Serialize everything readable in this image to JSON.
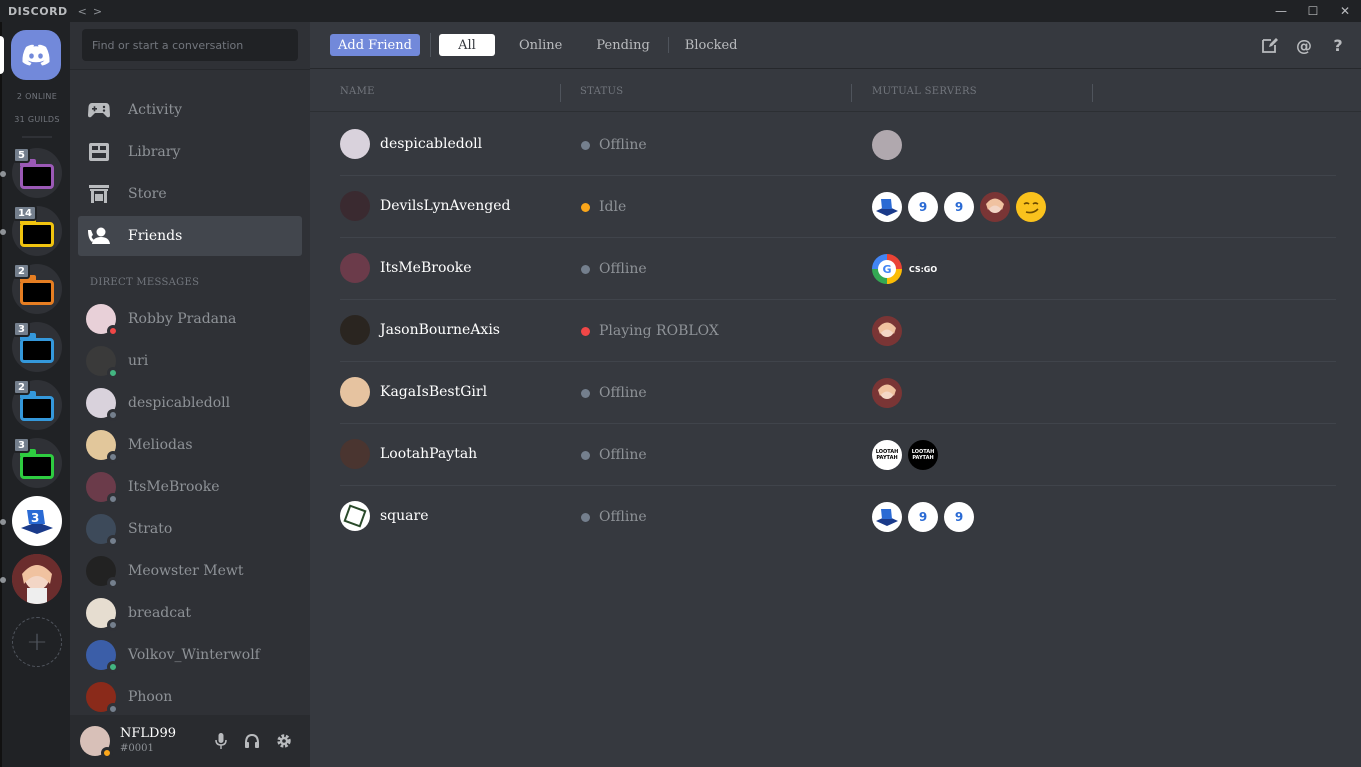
{
  "app": {
    "title": "DISCORD",
    "nav_back": "<",
    "nav_fwd": ">"
  },
  "window": {
    "min": "—",
    "max": "☐",
    "close": "✕"
  },
  "guilds": {
    "online": "2 ONLINE",
    "count": "31 GUILDS",
    "folders": [
      {
        "badge": "5",
        "color": "#9b59b6"
      },
      {
        "badge": "14",
        "color": "#f1c40f"
      },
      {
        "badge": "2",
        "color": "#e67e22"
      },
      {
        "badge": "3",
        "color": "#3498db"
      },
      {
        "badge": "2",
        "color": "#3498db"
      },
      {
        "badge": "3",
        "color": "#2ecc40"
      }
    ],
    "add": "+"
  },
  "sidebar": {
    "search_placeholder": "Find or start a conversation",
    "nav": [
      {
        "label": "Activity",
        "icon": "gamepad-icon"
      },
      {
        "label": "Library",
        "icon": "library-icon"
      },
      {
        "label": "Store",
        "icon": "store-icon"
      },
      {
        "label": "Friends",
        "icon": "friends-icon"
      }
    ],
    "dm_header": "DIRECT MESSAGES",
    "dms": [
      {
        "name": "Robby Pradana",
        "status": "dnd"
      },
      {
        "name": "uri",
        "status": "online"
      },
      {
        "name": "despicabledoll",
        "status": "offline"
      },
      {
        "name": "Meliodas",
        "status": "offline"
      },
      {
        "name": "ItsMeBrooke",
        "status": "offline"
      },
      {
        "name": "Strato",
        "status": "offline"
      },
      {
        "name": "Meowster Mewt",
        "status": "offline"
      },
      {
        "name": "breadcat",
        "status": "offline"
      },
      {
        "name": "Volkov_Winterwolf",
        "status": "online"
      },
      {
        "name": "Phoon",
        "status": "offline"
      }
    ],
    "user": {
      "name": "NFLD99",
      "tag": "#0001",
      "status": "idle"
    }
  },
  "colors": {
    "blurple": "#7289da",
    "online": "#43b581",
    "idle": "#faa61a",
    "dnd": "#f04747",
    "offline": "#747f8d"
  },
  "topbar": {
    "add_friend": "Add Friend",
    "tabs": [
      "All",
      "Online",
      "Pending",
      "Blocked"
    ],
    "active_tab": "All"
  },
  "table": {
    "headers": [
      "NAME",
      "STATUS",
      "MUTUAL SERVERS"
    ],
    "rows": [
      {
        "name": "despicabledoll",
        "status": "Offline",
        "state": "offline",
        "servers": [
          "anime"
        ]
      },
      {
        "name": "DevilsLynAvenged",
        "status": "Idle",
        "state": "idle",
        "servers": [
          "blue-3d",
          "g9",
          "g9",
          "anime",
          "smirk-emoji"
        ]
      },
      {
        "name": "ItsMeBrooke",
        "status": "Offline",
        "state": "offline",
        "servers": [
          "google",
          "csgo"
        ]
      },
      {
        "name": "JasonBourneAxis",
        "status": "Playing ROBLOX",
        "state": "dnd",
        "servers": [
          "anime"
        ]
      },
      {
        "name": "KagaIsBestGirl",
        "status": "Offline",
        "state": "offline",
        "servers": [
          "anime"
        ]
      },
      {
        "name": "LootahPaytah",
        "status": "Offline",
        "state": "offline",
        "servers": [
          "lootah-white",
          "lootah-black"
        ]
      },
      {
        "name": "square",
        "status": "Offline",
        "state": "offline",
        "servers": [
          "blue-3d",
          "g9",
          "g9"
        ]
      }
    ],
    "server_labels": {
      "g9": "9",
      "csgo": "CS:GO",
      "google": "G",
      "lootah": "LOOTAH PAYTAH"
    }
  }
}
